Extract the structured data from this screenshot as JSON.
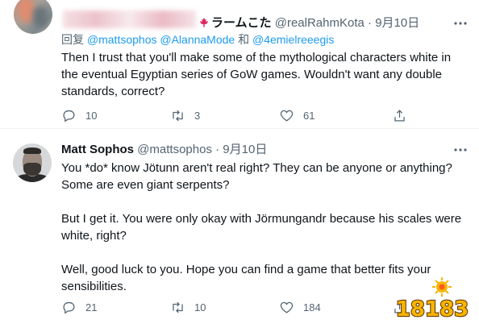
{
  "tweet1": {
    "display_name": "ラームこた",
    "handle": "@realRahmKota",
    "separator": "·",
    "date": "9月10日",
    "reply_prefix": "回复",
    "reply_mentions": [
      "@mattsophos",
      "@AlannaMode"
    ],
    "reply_and": "和",
    "reply_last_mention": "@4emielreeegis",
    "text": "Then I trust that you'll make some of the mythological characters white in the eventual Egyptian series of GoW games. Wouldn't want any double standards, correct?",
    "replies": "10",
    "retweets": "3",
    "likes": "61"
  },
  "tweet2": {
    "display_name": "Matt Sophos",
    "handle": "@mattsophos",
    "separator": "·",
    "date": "9月10日",
    "paragraphs": [
      "You *do* know Jötunn aren't real right? They can be anyone or anything? Some are even giant serpents?",
      "But I get it. You were only okay with Jörmungandr because his scales were white, right?",
      "Well, good luck to you. Hope you can find a game that better fits your sensibilities."
    ],
    "replies": "21",
    "retweets": "10",
    "likes": "184"
  },
  "icons": {
    "reply": "reply-bubble-icon",
    "retweet": "retweet-icon",
    "like": "heart-icon",
    "share": "share-upload-icon",
    "more": "more-dots-icon",
    "flag": "maple-leaf-icon"
  },
  "colors": {
    "text": "#0f1419",
    "secondary": "#536471",
    "link": "#1d9bf0",
    "divider": "#eff3f4",
    "flag": "#e0245e"
  },
  "watermark": {
    "text": "18183"
  }
}
